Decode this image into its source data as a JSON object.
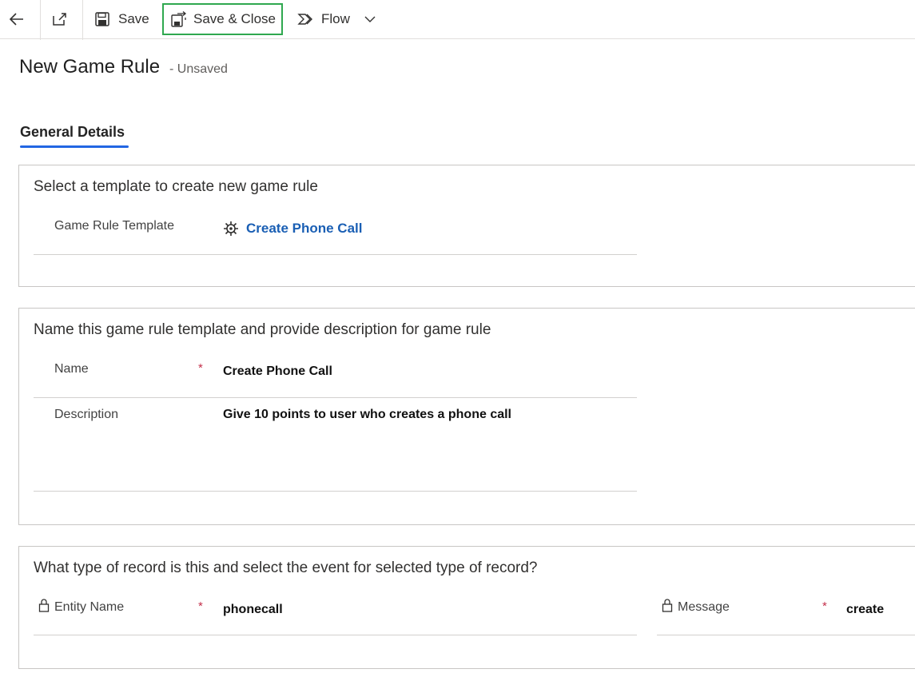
{
  "toolbar": {
    "save_label": "Save",
    "save_close_label": "Save & Close",
    "flow_label": "Flow"
  },
  "header": {
    "title": "New Game Rule",
    "status": "- Unsaved"
  },
  "tabs": [
    {
      "label": "General Details"
    }
  ],
  "sections": {
    "template": {
      "title": "Select a template to create new game rule",
      "field_label": "Game Rule Template",
      "field_value": "Create Phone Call"
    },
    "naming": {
      "title": "Name this game rule template and provide description for game rule",
      "name_label": "Name",
      "name_value": "Create Phone Call",
      "description_label": "Description",
      "description_value": "Give 10 points to user who creates a phone call"
    },
    "record": {
      "title": "What type of record is this and select the event for selected type of record?",
      "entity_label": "Entity Name",
      "entity_value": "phonecall",
      "message_label": "Message",
      "message_value": "create"
    }
  },
  "required_marker": "*",
  "colors": {
    "accent": "#2266e3",
    "link": "#1a5fb4",
    "highlight_border": "#2fa84f",
    "required": "#c4314b"
  }
}
